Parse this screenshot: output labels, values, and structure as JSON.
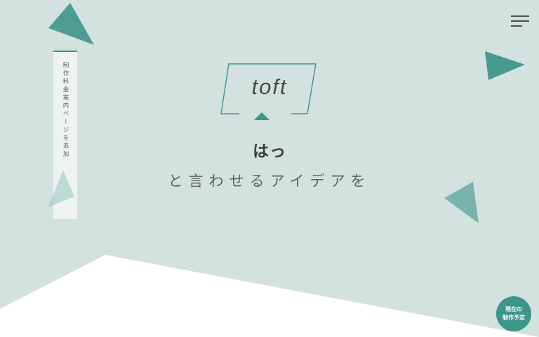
{
  "brand": {
    "logo_text": "toft",
    "accent_color": "#3e968a",
    "background_color": "#d3e2df"
  },
  "hero": {
    "tagline_line1": "はっ",
    "tagline_line2": "と言わせるアイデアを"
  },
  "news_banner": {
    "text": "制作料金案内ページを追加"
  },
  "header": {
    "menu_icon": "hamburger-menu-icon"
  },
  "schedule_badge": {
    "line1": "現在の",
    "line2": "制作予定"
  }
}
